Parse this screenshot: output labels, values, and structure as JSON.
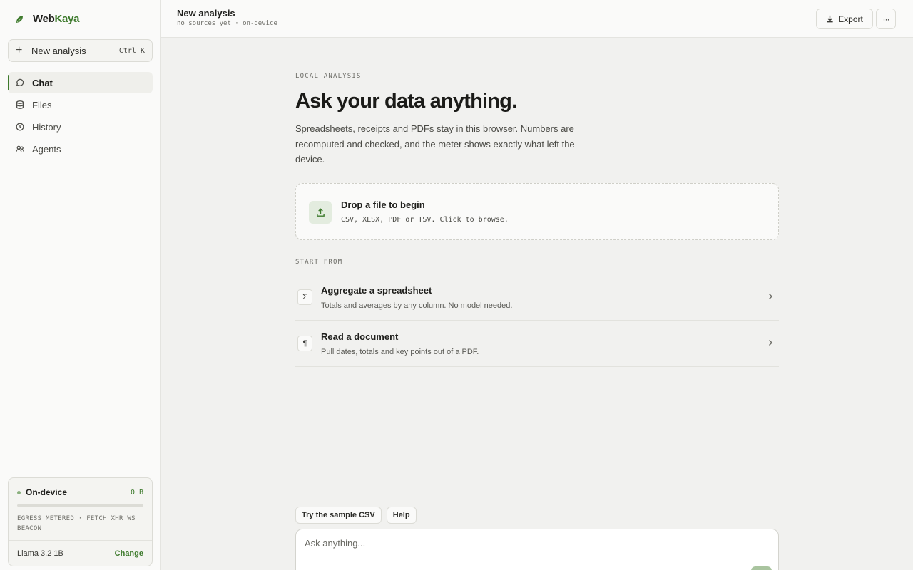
{
  "brand": {
    "name_part1": "Web",
    "name_part2": "Kaya",
    "logo_icon": "leaf-logo-icon",
    "accent": "#3d7a2c"
  },
  "sidebar": {
    "new_button": {
      "label": "New analysis",
      "shortcut": "Ctrl K"
    },
    "nav": [
      {
        "label": "Chat",
        "icon": "chat-bubble-icon",
        "active": true
      },
      {
        "label": "Files",
        "icon": "database-icon",
        "active": false
      },
      {
        "label": "History",
        "icon": "clock-icon",
        "active": false
      },
      {
        "label": "Agents",
        "icon": "users-icon",
        "active": false
      }
    ],
    "device": {
      "title": "On-device",
      "bytes": "0 B",
      "egress_fraction": 0,
      "egress_line": "EGRESS METERED · FETCH XHR WS BEACON",
      "model": "Llama 3.2 1B",
      "change_label": "Change"
    }
  },
  "header": {
    "title": "New analysis",
    "subtitle": "no sources yet · on-device",
    "export_label": "Export",
    "more_label": "···"
  },
  "main": {
    "eyebrow": "LOCAL ANALYSIS",
    "hero": "Ask your data anything.",
    "lede": "Spreadsheets, receipts and PDFs stay in this browser. Numbers are recomputed and checked, and the meter shows exactly what left the device.",
    "drop": {
      "title": "Drop a file to begin",
      "subtitle": "CSV, XLSX, PDF or TSV. Click to browse.",
      "icon": "upload-icon"
    },
    "start_label": "START FROM",
    "start_items": [
      {
        "icon_glyph": "Σ",
        "title": "Aggregate a spreadsheet",
        "desc": "Totals and averages by any column. No model needed."
      },
      {
        "icon_glyph": "¶",
        "title": "Read a document",
        "desc": "Pull dates, totals and key points out of a PDF."
      }
    ]
  },
  "composer": {
    "chips": [
      "Try the sample CSV",
      "Help"
    ],
    "placeholder": "Ask anything..."
  }
}
